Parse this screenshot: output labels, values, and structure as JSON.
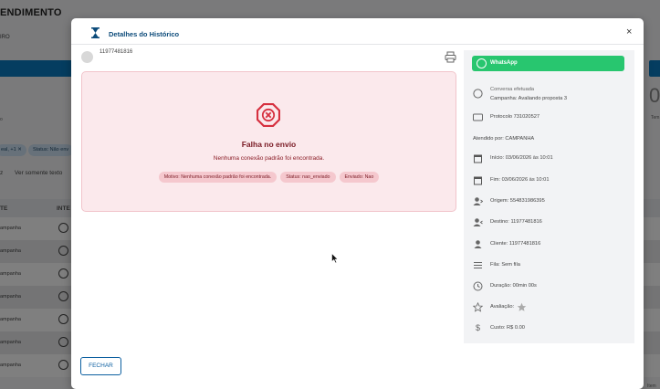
{
  "background": {
    "title": "ENDIMENTO",
    "subtitle": "IRO",
    "chips": [
      "eal, +1 ✕",
      "Status: Não env"
    ],
    "filter_text": "z",
    "view_text_label": "Ver somente texto",
    "table_header": [
      "TE",
      "INTE"
    ],
    "row_label": "ampanha",
    "right_big": "0",
    "right_label": "Tem",
    "left_label": "o",
    "right_bottom": "Item"
  },
  "modal": {
    "title": "Detalhes do Histórico",
    "close": "×",
    "contact_phone": "11977481816",
    "error": {
      "title": "Falha no envio",
      "message": "Nenhuma conexão padrão foi encontrada.",
      "chips": [
        "Motivo: Nenhuma conexão padrão foi encontrada.",
        "Status: nao_enviado",
        "Enviado: Nao"
      ]
    },
    "sidebar": {
      "channel_button": "WhatsApp",
      "conversation_status": "Conversa efetuada",
      "campaign": "Campanha: Avaliando proposta 3",
      "protocol": "Protocolo 731020527",
      "attended_by": "Atendido por: CAMPANHA",
      "start": "Início: 03/06/2026 às 10:01",
      "end": "Fim: 03/06/2026 às 10:01",
      "origin": "Origem: 554831986395",
      "destination": "Destino: 11977481816",
      "client": "Cliente: 11977481816",
      "queue": "Fila: Sem fila",
      "duration": "Duração: 00min 00s",
      "rating": "Avaliação:",
      "cost": "Custo: R$ 0.00"
    },
    "close_button": "FECHAR"
  },
  "colors": {
    "accent": "#0c5fa0",
    "whatsapp": "#28c66f",
    "error_bg": "#fbe9ec",
    "error_text": "#7a1a24",
    "error_icon": "#d6303f"
  }
}
